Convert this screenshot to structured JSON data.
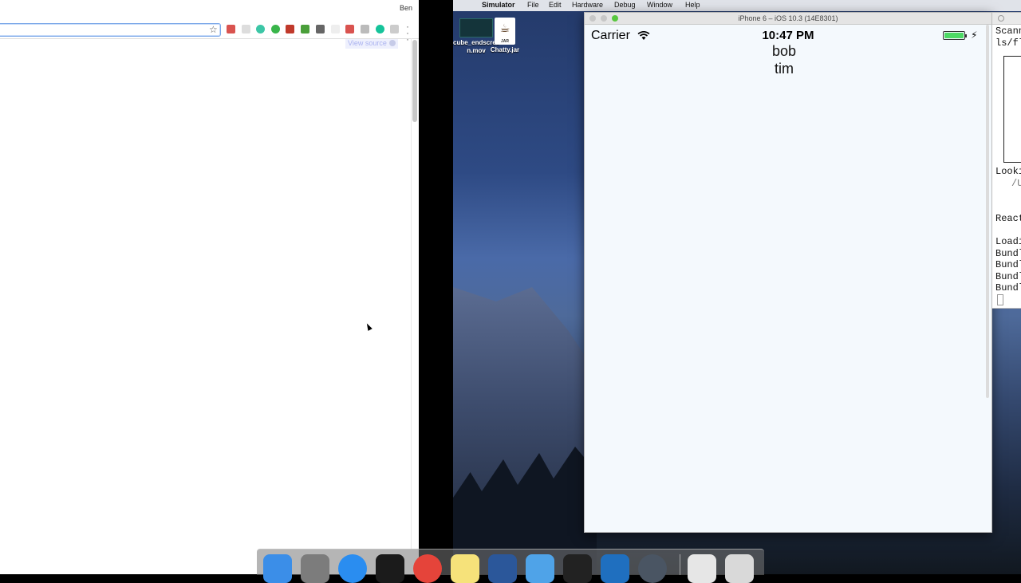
{
  "chrome": {
    "profile_name": "Ben",
    "view_source_label": "View source",
    "extensions": [
      {
        "icon": "lastpass-icon",
        "color": "#d9534f"
      },
      {
        "icon": "feather-icon",
        "color": "#dddddd"
      },
      {
        "icon": "m-circle-icon",
        "color": "#3cc6a6"
      },
      {
        "icon": "b-circle-icon",
        "color": "#39b54a"
      },
      {
        "icon": "ublock-icon",
        "color": "#c0392b"
      },
      {
        "icon": "v-icon",
        "color": "#4a9f3a"
      },
      {
        "icon": "pocket-icon",
        "color": "#666666"
      },
      {
        "icon": "blank-ext-icon",
        "color": "#eeeeee"
      },
      {
        "icon": "one-icon",
        "color": "#d9534f"
      },
      {
        "icon": "grid-icon",
        "color": "#bbbbbb"
      },
      {
        "icon": "grammarly-icon",
        "color": "#15c39a"
      },
      {
        "icon": "tab-icon",
        "color": "#cccccc"
      }
    ]
  },
  "menubar": {
    "app": "Simulator",
    "items": [
      "File",
      "Edit",
      "Hardware",
      "Debug",
      "Window",
      "Help"
    ]
  },
  "desktop": {
    "icons": [
      {
        "label": "cube_endscree n.mov",
        "icon": "movie-file-icon"
      },
      {
        "label": "Chatty.jar",
        "icon": "jar-file-icon",
        "badge": "JAR"
      }
    ]
  },
  "simulator": {
    "window_title": "iPhone 6 – iOS 10.3 (14E8301)",
    "carrier": "Carrier",
    "time": "10:47 PM",
    "list": [
      "bob",
      "tim"
    ],
    "battery_level": 1.0
  },
  "terminal": {
    "lines": [
      "Scann",
      "ls/fl",
      "Looki",
      "/U",
      "React",
      "Loadi",
      "Bundl",
      "Bundl",
      "Bundl",
      "Bundl"
    ]
  },
  "dock": {
    "apps": [
      {
        "icon": "finder-icon",
        "color": "#3b8ee8"
      },
      {
        "icon": "system-preferences-icon",
        "color": "#7c7c7c"
      },
      {
        "icon": "app-store-icon",
        "color": "#2a8df0"
      },
      {
        "icon": "terminal-green-icon",
        "color": "#1b1b1b"
      },
      {
        "icon": "chrome-icon",
        "color": "#e5443a"
      },
      {
        "icon": "stickies-icon",
        "color": "#f6e27a"
      },
      {
        "icon": "word-icon",
        "color": "#2b579a"
      },
      {
        "icon": "xcode-icon",
        "color": "#4fa3e8"
      },
      {
        "icon": "terminal-icon",
        "color": "#222222"
      },
      {
        "icon": "vscode-icon",
        "color": "#1f6fbf"
      },
      {
        "icon": "quicktime-icon",
        "color": "#4a5563"
      },
      {
        "icon": "documents-icon",
        "color": "#e6e6e6"
      },
      {
        "icon": "trash-icon",
        "color": "#d9d9d9"
      }
    ]
  }
}
